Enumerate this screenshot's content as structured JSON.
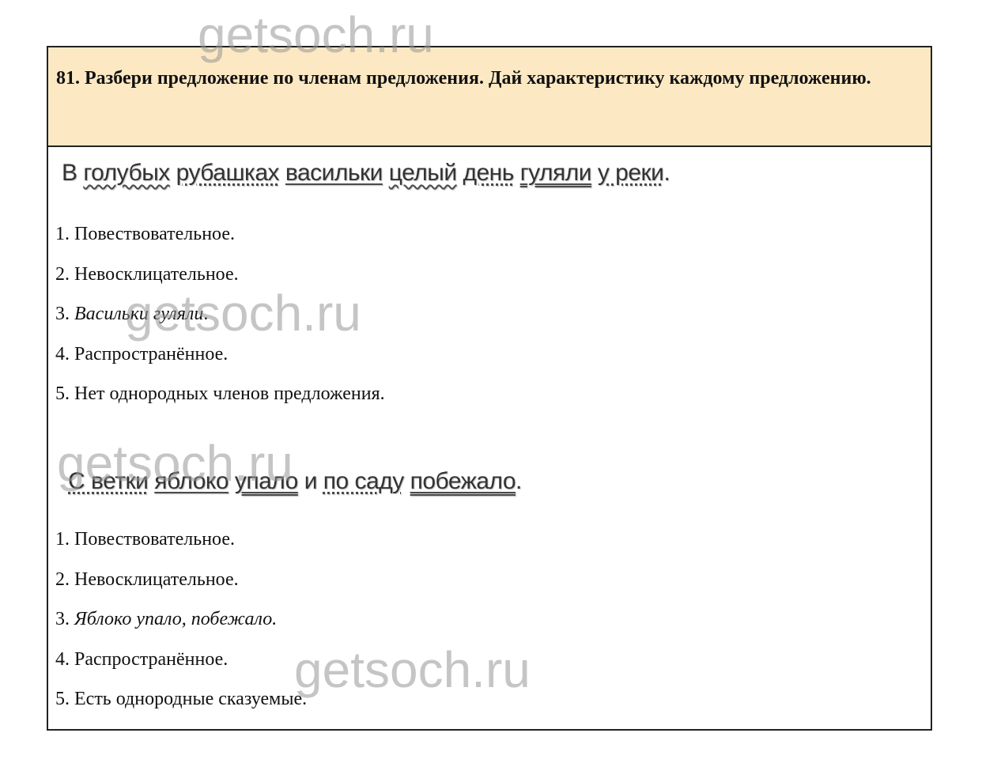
{
  "watermark": "getsoch.ru",
  "task": {
    "text": "81. Разбери предложение по членам предложения. Дай характеристику каждому предложению."
  },
  "sentence1": {
    "words": [
      {
        "text": "В",
        "mark": "none"
      },
      {
        "text": "голубых",
        "mark": "wavy"
      },
      {
        "text": "рубашках",
        "mark": "dotdash"
      },
      {
        "text": "васильки",
        "mark": "solid"
      },
      {
        "text": "целый",
        "mark": "wavy"
      },
      {
        "text": "день",
        "mark": "dotdash"
      },
      {
        "text": "гуляли",
        "mark": "double"
      },
      {
        "text": "у реки",
        "mark": "dotdash"
      }
    ],
    "end": "."
  },
  "analysis1": [
    {
      "num": "1.",
      "text": "Повествовательное.",
      "italic": false
    },
    {
      "num": "2.",
      "text": "Невосклицательное.",
      "italic": false
    },
    {
      "num": "3.",
      "text": "Васильки гуляли",
      "italic": true,
      "tail": "."
    },
    {
      "num": "4.",
      "text": "Распространённое.",
      "italic": false
    },
    {
      "num": "5.",
      "text": "Нет однородных членов предложения.",
      "italic": false
    }
  ],
  "sentence2": {
    "words": [
      {
        "text": "С ветки",
        "mark": "dotdash"
      },
      {
        "text": "яблоко",
        "mark": "solid"
      },
      {
        "text": "упало",
        "mark": "double"
      },
      {
        "text": "и",
        "mark": "none"
      },
      {
        "text": "по саду",
        "mark": "dotdash"
      },
      {
        "text": "побежало",
        "mark": "double"
      }
    ],
    "end": "."
  },
  "analysis2": [
    {
      "num": "1.",
      "text": "Повествовательное.",
      "italic": false
    },
    {
      "num": "2.",
      "text": "Невосклицательное.",
      "italic": false
    },
    {
      "num": "3.",
      "text": "Яблоко упало, побежало.",
      "italic": true,
      "tail": ""
    },
    {
      "num": "4.",
      "text": "Распространённое.",
      "italic": false
    },
    {
      "num": "5.",
      "text": "Есть однородные сказуемые.",
      "italic": false
    }
  ]
}
